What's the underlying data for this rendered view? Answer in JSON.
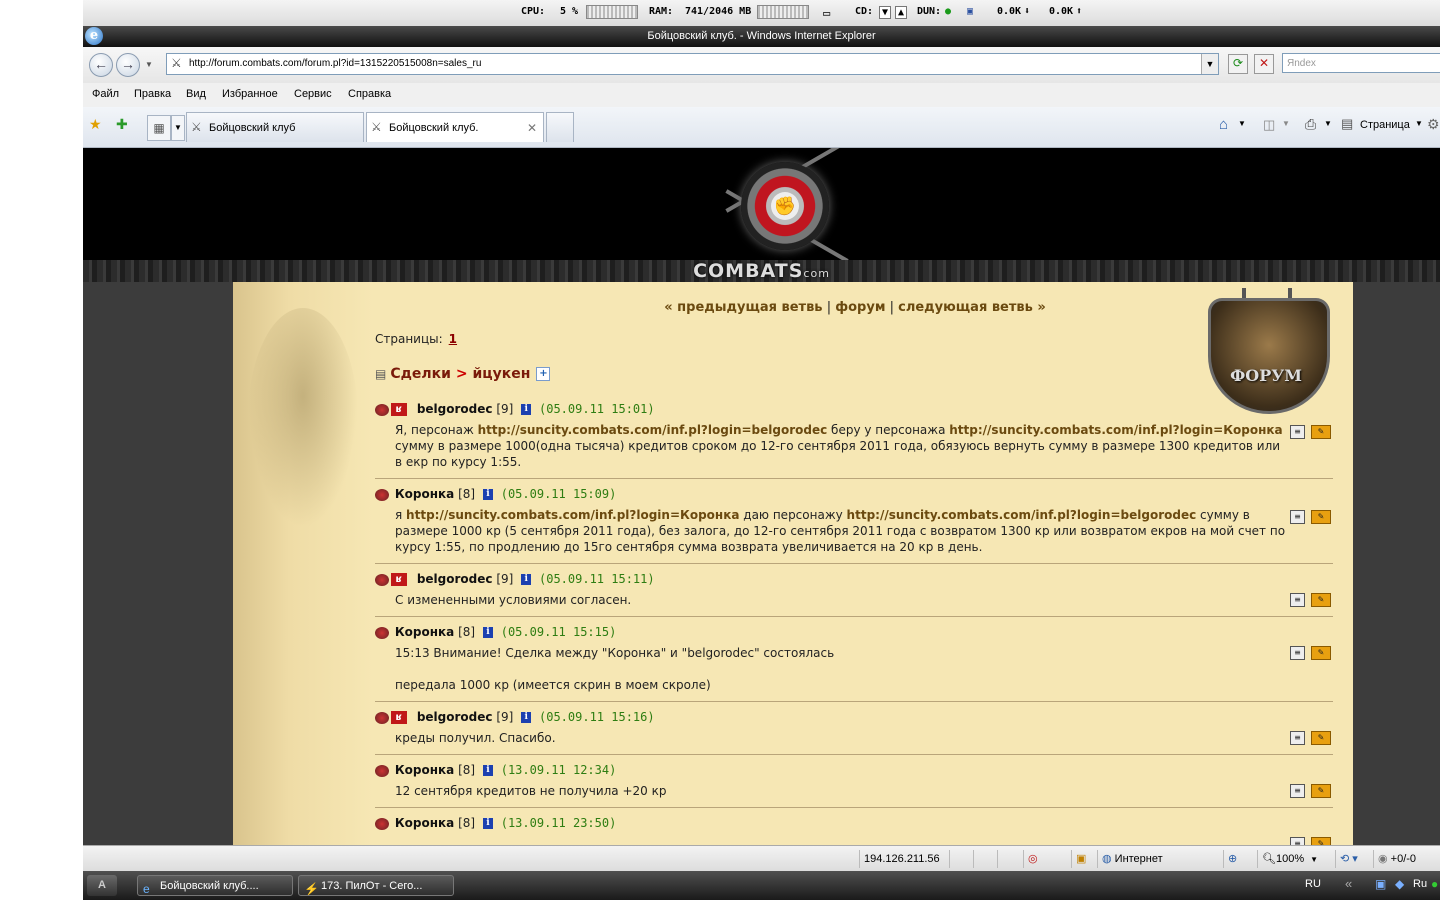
{
  "sysbar": {
    "cpu_label": "CPU:",
    "cpu_value": "5 %",
    "ram_label": "RAM:",
    "ram_value": "741/2046 MB",
    "cd_label": "CD:",
    "dun_label": "DUN:",
    "down_rate": "0.0K",
    "up_rate": "0.0K"
  },
  "window": {
    "title": "Бойцовский клуб. - Windows Internet Explorer"
  },
  "addressbar": {
    "url": "http://forum.combats.com/forum.pl?id=1315220515008n=sales_ru",
    "search_placeholder": "Яndex"
  },
  "menu": [
    "Файл",
    "Правка",
    "Вид",
    "Избранное",
    "Сервис",
    "Справка"
  ],
  "tabs": [
    {
      "label": "Бойцовский клуб"
    },
    {
      "label": "Бойцовский клуб."
    }
  ],
  "toolbar_right": {
    "page_label": "Страница"
  },
  "banner": {
    "brand": "COMBATS",
    "brand_suffix": "com"
  },
  "forum": {
    "badge": "ФОРУМ",
    "nav_prev": "« предыдущая ветвь",
    "nav_forum": "форум",
    "nav_next": "следующая ветвь »",
    "sep": "|",
    "pages_label": "Страницы:",
    "page_1": "1",
    "crumb_section": "Сделки",
    "crumb_arrow": ">",
    "crumb_topic": "йцукен",
    "posts": [
      {
        "nick": "belgorodec",
        "level": "[9]",
        "date": "(05.09.11 15:01)",
        "t1": "Я, персонаж ",
        "l1": "http://suncity.combats.com/inf.pl?login=belgorodec",
        "t2": " беру у персонажа ",
        "l2": "http://suncity.combats.com/inf.pl?login=Коронка",
        "t3": " сумму в размере 1000(одна тысяча) кредитов сроком до 12-го сентября 2011 года, обязуюсь вернуть сумму в размере 1300 кредитов или в екр по курсу 1:55."
      },
      {
        "nick": "Коронка",
        "level": "[8]",
        "date": "(05.09.11 15:09)",
        "t1": "я ",
        "l1": "http://suncity.combats.com/inf.pl?login=Коронка",
        "t2": " даю персонажу ",
        "l2": "http://suncity.combats.com/inf.pl?login=belgorodec",
        "t3": " сумму в размере 1000 кр (5 сентября 2011 года), без залога, до 12-го сентября 2011 года с возвратом 1300 кр или возвратом екров на мой счет по курсу 1:55, по продлению до 15го сентября сумма возврата увеличивается на 20 кр в день."
      },
      {
        "nick": "belgorodec",
        "level": "[9]",
        "date": "(05.09.11 15:11)",
        "text": "С измененными условиями согласен."
      },
      {
        "nick": "Коронка",
        "level": "[8]",
        "date": "(05.09.11 15:15)",
        "text": "15:13 Внимание! Сделка между \"Коронка\" и \"belgorodec\" состоялась",
        "text2": "передала 1000 кр (имеется скрин в моем скроле)"
      },
      {
        "nick": "belgorodec",
        "level": "[9]",
        "date": "(05.09.11 15:16)",
        "text": "креды получил. Спасибо."
      },
      {
        "nick": "Коронка",
        "level": "[8]",
        "date": "(13.09.11 12:34)",
        "text": "12 сентября кредитов не получила +20 кр"
      },
      {
        "nick": "Коронка",
        "level": "[8]",
        "date": "(13.09.11 23:50)",
        "text": ""
      }
    ]
  },
  "statusbar": {
    "ip": "194.126.211.56",
    "zone": "Интернет",
    "zoom": "100%",
    "counter": "+0/-0"
  },
  "taskbar": {
    "items": [
      {
        "label": "Бойцовский клуб...."
      },
      {
        "label": "173. ПилОт - Сего..."
      }
    ],
    "lang": "RU",
    "lang2": "Ru"
  }
}
